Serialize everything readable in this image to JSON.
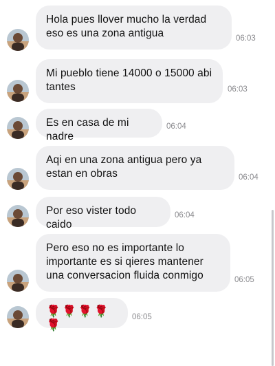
{
  "messages": [
    {
      "text": "Hola pues llover mucho la verdad eso es una zona antigua",
      "time": "06:03"
    },
    {
      "text": "Mi pueblo tiene 14000 o 15000 abi tantes",
      "time": "06:03"
    },
    {
      "text": "Es en casa de mi nadre",
      "time": "06:04"
    },
    {
      "text": "Aqi en una zona antigua pero ya estan en obras",
      "time": "06:04"
    },
    {
      "text": "Por eso vister todo caido",
      "time": "06:04"
    },
    {
      "text": "Pero eso no es importante lo importante es si qieres mantener una conversacion fluida conmigo",
      "time": "06:05"
    },
    {
      "text": "🌹🌹🌹🌹🌹",
      "time": "06:05"
    }
  ]
}
